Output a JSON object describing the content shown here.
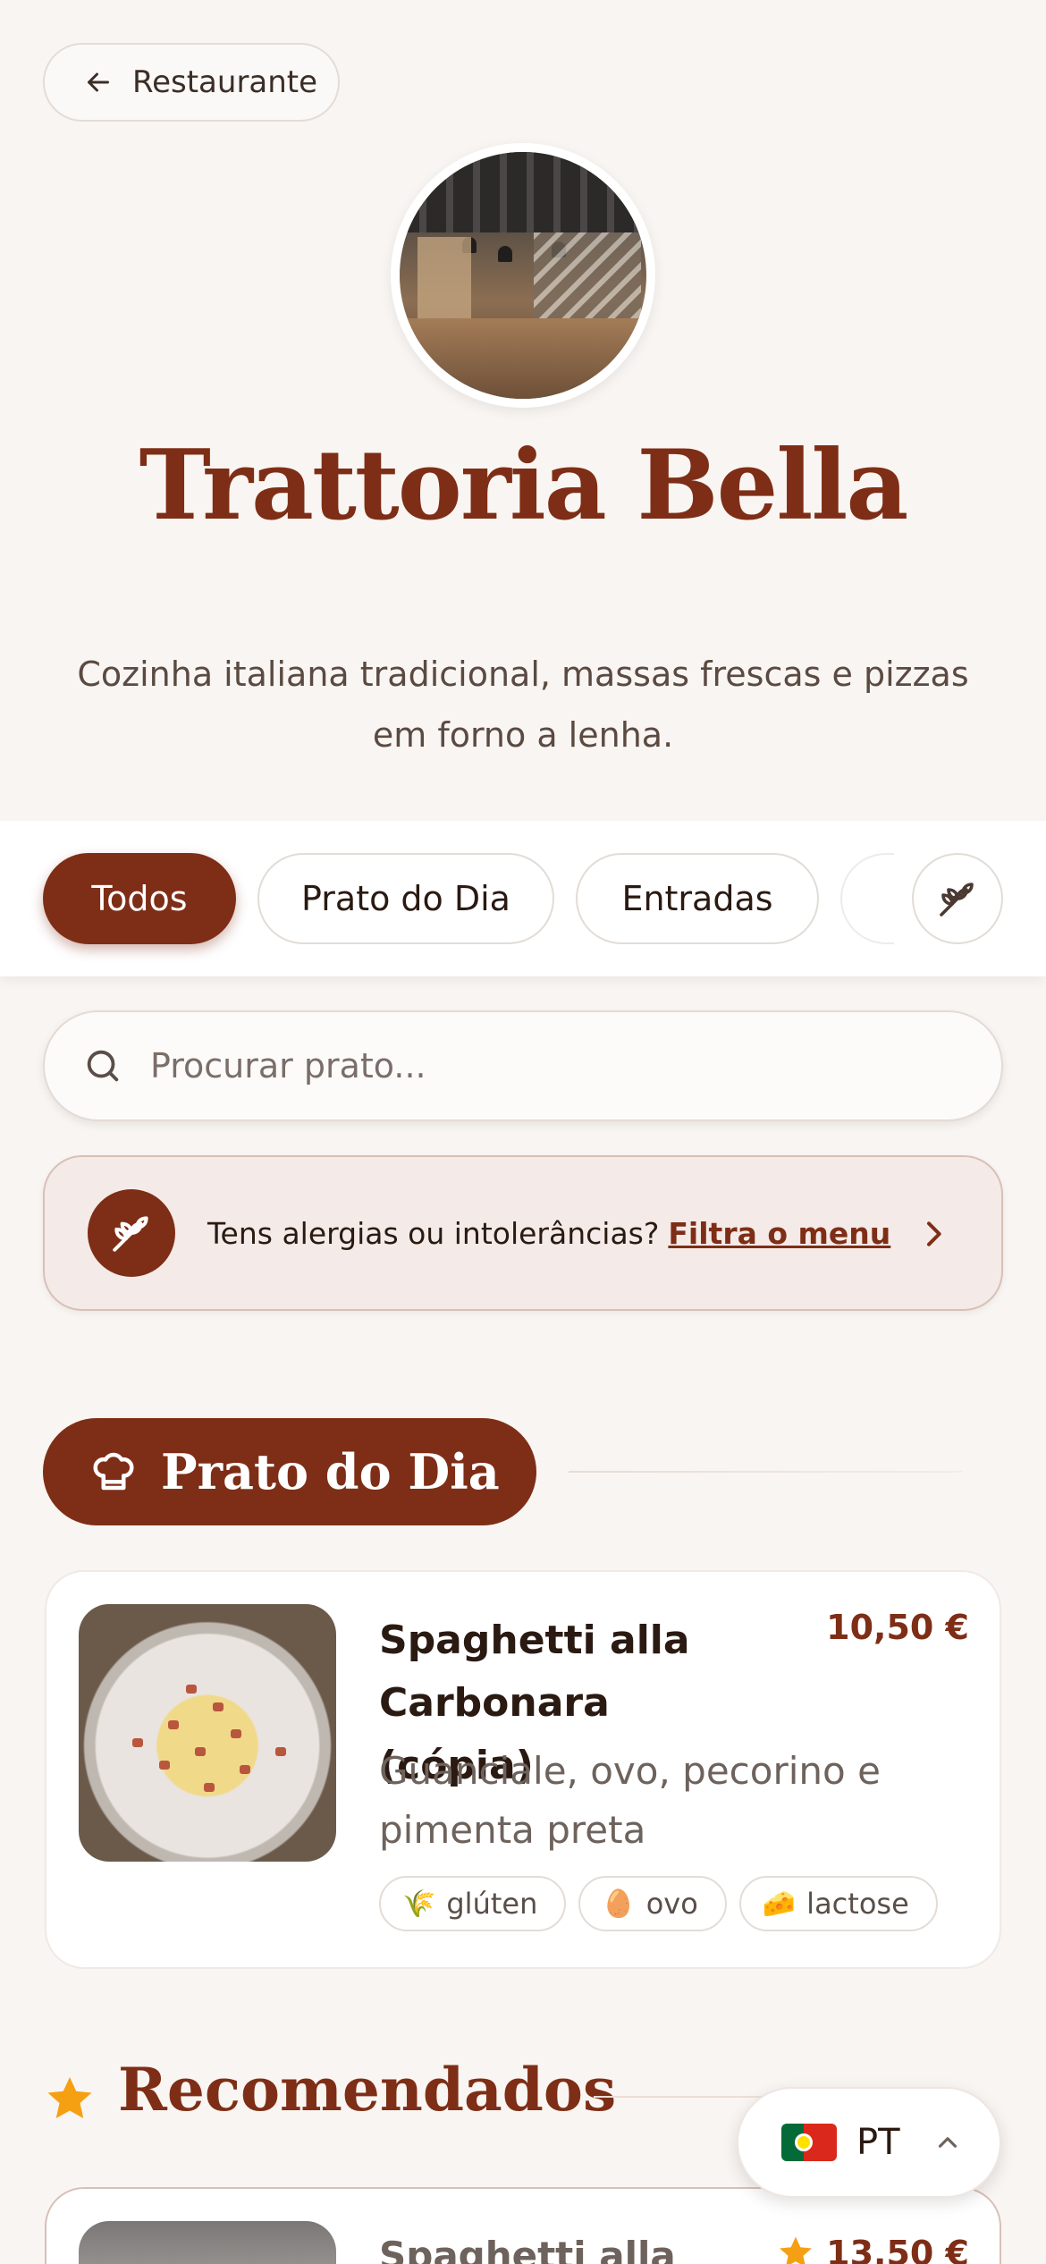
{
  "header": {
    "back_label": "Restaurante",
    "restaurant_name": "Trattoria Bella",
    "description": "Cozinha italiana tradicional, massas frescas e pizzas em forno a lenha."
  },
  "categories": {
    "items": [
      {
        "label": "Todos",
        "active": true
      },
      {
        "label": "Prato do Dia",
        "active": false
      },
      {
        "label": "Entradas",
        "active": false
      }
    ],
    "allergen_filter_icon": "wheat-icon"
  },
  "search": {
    "placeholder": "Procurar prato..."
  },
  "allergy_banner": {
    "text": "Tens alergias ou intolerâncias?",
    "link": "Filtra o menu"
  },
  "sections": {
    "daily": {
      "title": "Prato do Dia",
      "icon": "chef-hat-icon",
      "dish": {
        "name": "Spaghetti alla Carbonara (cópia)",
        "price": "10,50 €",
        "description": "Guanciale, ovo, pecorino e pimenta preta",
        "allergens": [
          {
            "emoji": "🌾",
            "label": "glúten"
          },
          {
            "emoji": "🥚",
            "label": "ovo"
          },
          {
            "emoji": "🧀",
            "label": "lactose"
          }
        ]
      }
    },
    "recommended": {
      "title": "Recomendados",
      "icon": "star-icon",
      "dish": {
        "name": "Spaghetti alla",
        "price": "13,50 €"
      }
    }
  },
  "language": {
    "code": "PT",
    "flag": "portugal-flag"
  },
  "colors": {
    "brand": "#7e2e16",
    "background": "#f9f5f2",
    "star": "#f5a012"
  }
}
